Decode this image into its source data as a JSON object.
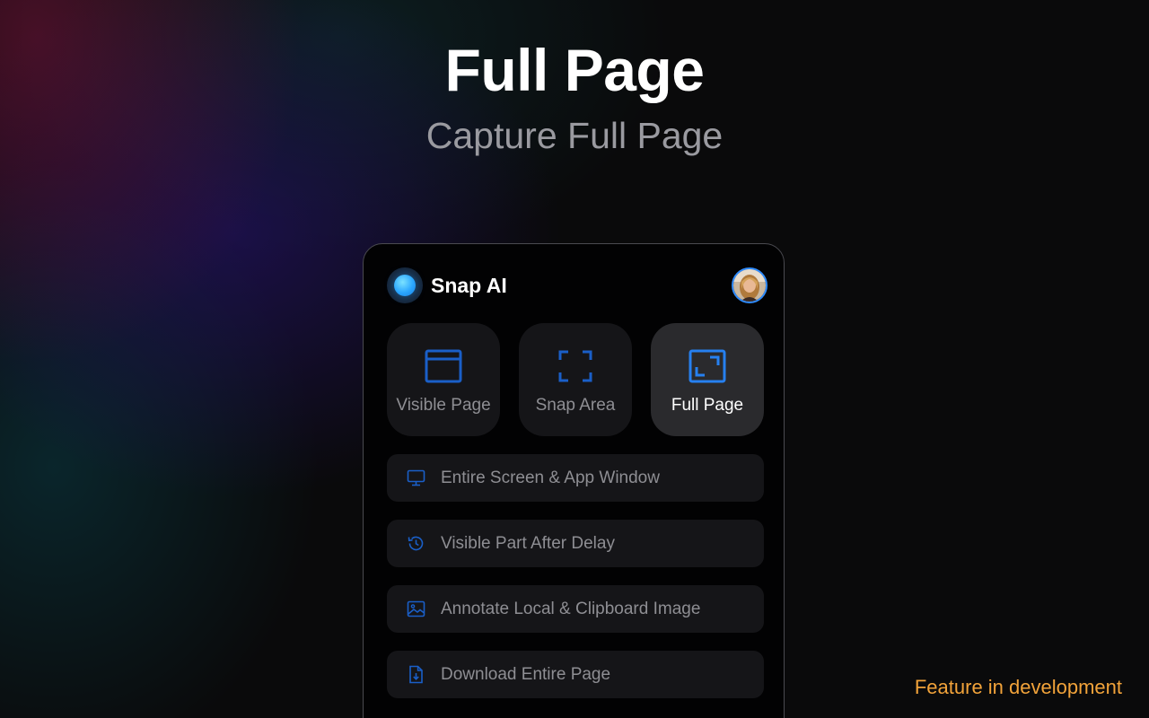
{
  "hero": {
    "title": "Full Page",
    "subtitle": "Capture Full Page"
  },
  "panel": {
    "app_name": "Snap AI",
    "logo_icon": "snap-ai-logo-icon",
    "avatar_icon": "user-avatar",
    "accent_color": "#1a6fe0",
    "tiles": [
      {
        "label": "Visible Page",
        "icon": "browser-window-icon",
        "active": false
      },
      {
        "label": "Snap Area",
        "icon": "crop-corners-icon",
        "active": false
      },
      {
        "label": "Full Page",
        "icon": "fullscreen-frame-icon",
        "active": true
      }
    ],
    "options": [
      {
        "label": "Entire Screen & App Window",
        "icon": "monitor-icon"
      },
      {
        "label": "Visible Part After Delay",
        "icon": "history-clock-icon"
      },
      {
        "label": "Annotate Local & Clipboard Image",
        "icon": "image-icon"
      },
      {
        "label": "Download Entire Page",
        "icon": "file-download-icon"
      }
    ]
  },
  "footer_note": {
    "text": "Feature in development",
    "color": "#f2a33a"
  }
}
